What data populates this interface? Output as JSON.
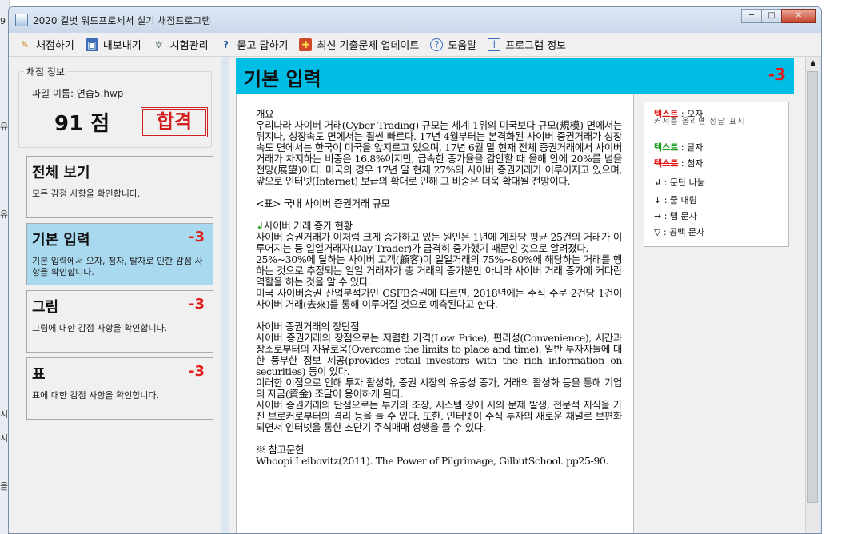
{
  "window": {
    "title": "2020 길벗 워드프로세서 실기 채점프로그램",
    "minimize": "─",
    "maximize": "□",
    "close": "✕"
  },
  "menu": [
    {
      "label": "채점하기",
      "icon": "pencil-icon"
    },
    {
      "label": "내보내기",
      "icon": "save-icon"
    },
    {
      "label": "시험관리",
      "icon": "gear-icon"
    },
    {
      "label": "묻고 답하기",
      "icon": "qa-icon"
    },
    {
      "label": "최신 기출문제 업데이트",
      "icon": "gift-icon"
    },
    {
      "label": "도움말",
      "icon": "help-icon"
    },
    {
      "label": "프로그램 정보",
      "icon": "info-icon"
    }
  ],
  "score": {
    "group_label": "채점 정보",
    "file_label": "파일 이름: 연습5.hwp",
    "score_text": "91 점",
    "result": "합격"
  },
  "cards": [
    {
      "title": "전체 보기",
      "penalty": "",
      "desc": "모든 감점 사항을 확인합니다."
    },
    {
      "title": "기본 입력",
      "penalty": "-3",
      "desc": "기본 입력에서 오자, 첨자, 탈자로 인한 감점 사항을 확인합니다."
    },
    {
      "title": "그림",
      "penalty": "-3",
      "desc": "그림에 대한 감점 사항을 확인합니다."
    },
    {
      "title": "표",
      "penalty": "-3",
      "desc": "표에 대한 감점 사항을 확인합니다."
    }
  ],
  "header": {
    "title": "기본 입력",
    "penalty": "-3"
  },
  "document": {
    "lines": [
      "개요",
      "우리나라 사이버 거래(Cyber Trading) 규모는 세계 1위의 미국보다 규모(規模) 면에서는 뒤지나, 성장속도 면에서는 훨씬 빠르다. 17년 4월부터는 본격화된 사이버 증권거래가 성장속도 면에서는 한국이 미국을 앞지르고 있으며, 17년 6월 말 현재 전체 증권거래에서 사이버 거래가 차지하는 비중은 16.8%이지만, 급속한 증가율을 감안할 때 올해 안에 20%를 넘을 전망(展望)이다. 미국의 경우 17년 말 현재 27%의 사이버 증권거래가 이루어지고 있으며, 앞으로 인터넷(Internet) 보급의 확대로 인해 그 비중은 더욱 확대될 전망이다.",
      "",
      "<표> 국내 사이버 증권거래 규모",
      "",
      "↲사이버 거래 증가 현황",
      "사이버 증권거래가 이처럼 크게 증가하고 있는 원인은 1년에 계좌당 평균 25건의 거래가 이루어지는 등 일일거래자(Day Trader)가 급격히 증가했기 때문인 것으로 알려졌다.",
      "25%~30%에 달하는 사이버 고객(顧客)이 일일거래의 75%~80%에 해당하는 거래를 행하는 것으로 추정되는 일일 거래자가 총 거래의 증가뿐만 아니라 사이버 거래 증가에 커다란 역할을 하는 것을 알 수 있다.",
      "미국 사이버증권 산업분석가인 CSFB증권에 따르면, 2018년에는 주식 주문 2건당 1건이 사이버 거래(去來)를 통해 이루어질 것으로 예측된다고 한다.",
      "",
      "사이버 증권거래의 장단점",
      "사이버 증권거래의 장점으로는 저렴한 가격(Low Price), 편리성(Convenience), 시간과 장소로부터의 자유로움(Overcome the limits to place and time), 일반 투자자들에 대한 풍부한 정보 제공(provides retail investors with the rich information on securities) 등이 있다.",
      "이러한 이점으로 인해 투자 활성화, 증권 시장의 유동성 증가, 거래의 활성화 등을 통해 기업의 자금(資金) 조달이 용이하게 된다.",
      "사이버 증권거래의 단점으로는 투기의 조장, 시스템 장애 시의 문제 발생, 전문적 지식을 가진 브로커로부터의 격리 등을 들 수 있다. 또한, 인터넷이 주식 투자의 새로운 채널로 보편화되면서 인터넷을 통한 초단기 주식매매 성행을 들 수 있다.",
      "",
      "※ 참고문헌",
      "Whoopi Leibovitz(2011). The Power of Pilgrimage, GilbutSchool. pp25-90."
    ]
  },
  "legend": {
    "typo_word": "텍스트",
    "typo_label": " : 오자",
    "typo_note": "커서를 올리면 정답 표시",
    "omit_word": "텍스트",
    "omit_label": " : 탈자",
    "extra_word": "텍스트",
    "extra_label": " : 첨자",
    "para": "↲ : 문단 나눔",
    "linebreak": "↓ : 줄 내림",
    "tab": "→ : 탭 문자",
    "space": "▽ : 공백 문자"
  },
  "desktop": {
    "edge_labels": [
      "9",
      "유",
      "유",
      "시",
      "시",
      "을"
    ]
  }
}
